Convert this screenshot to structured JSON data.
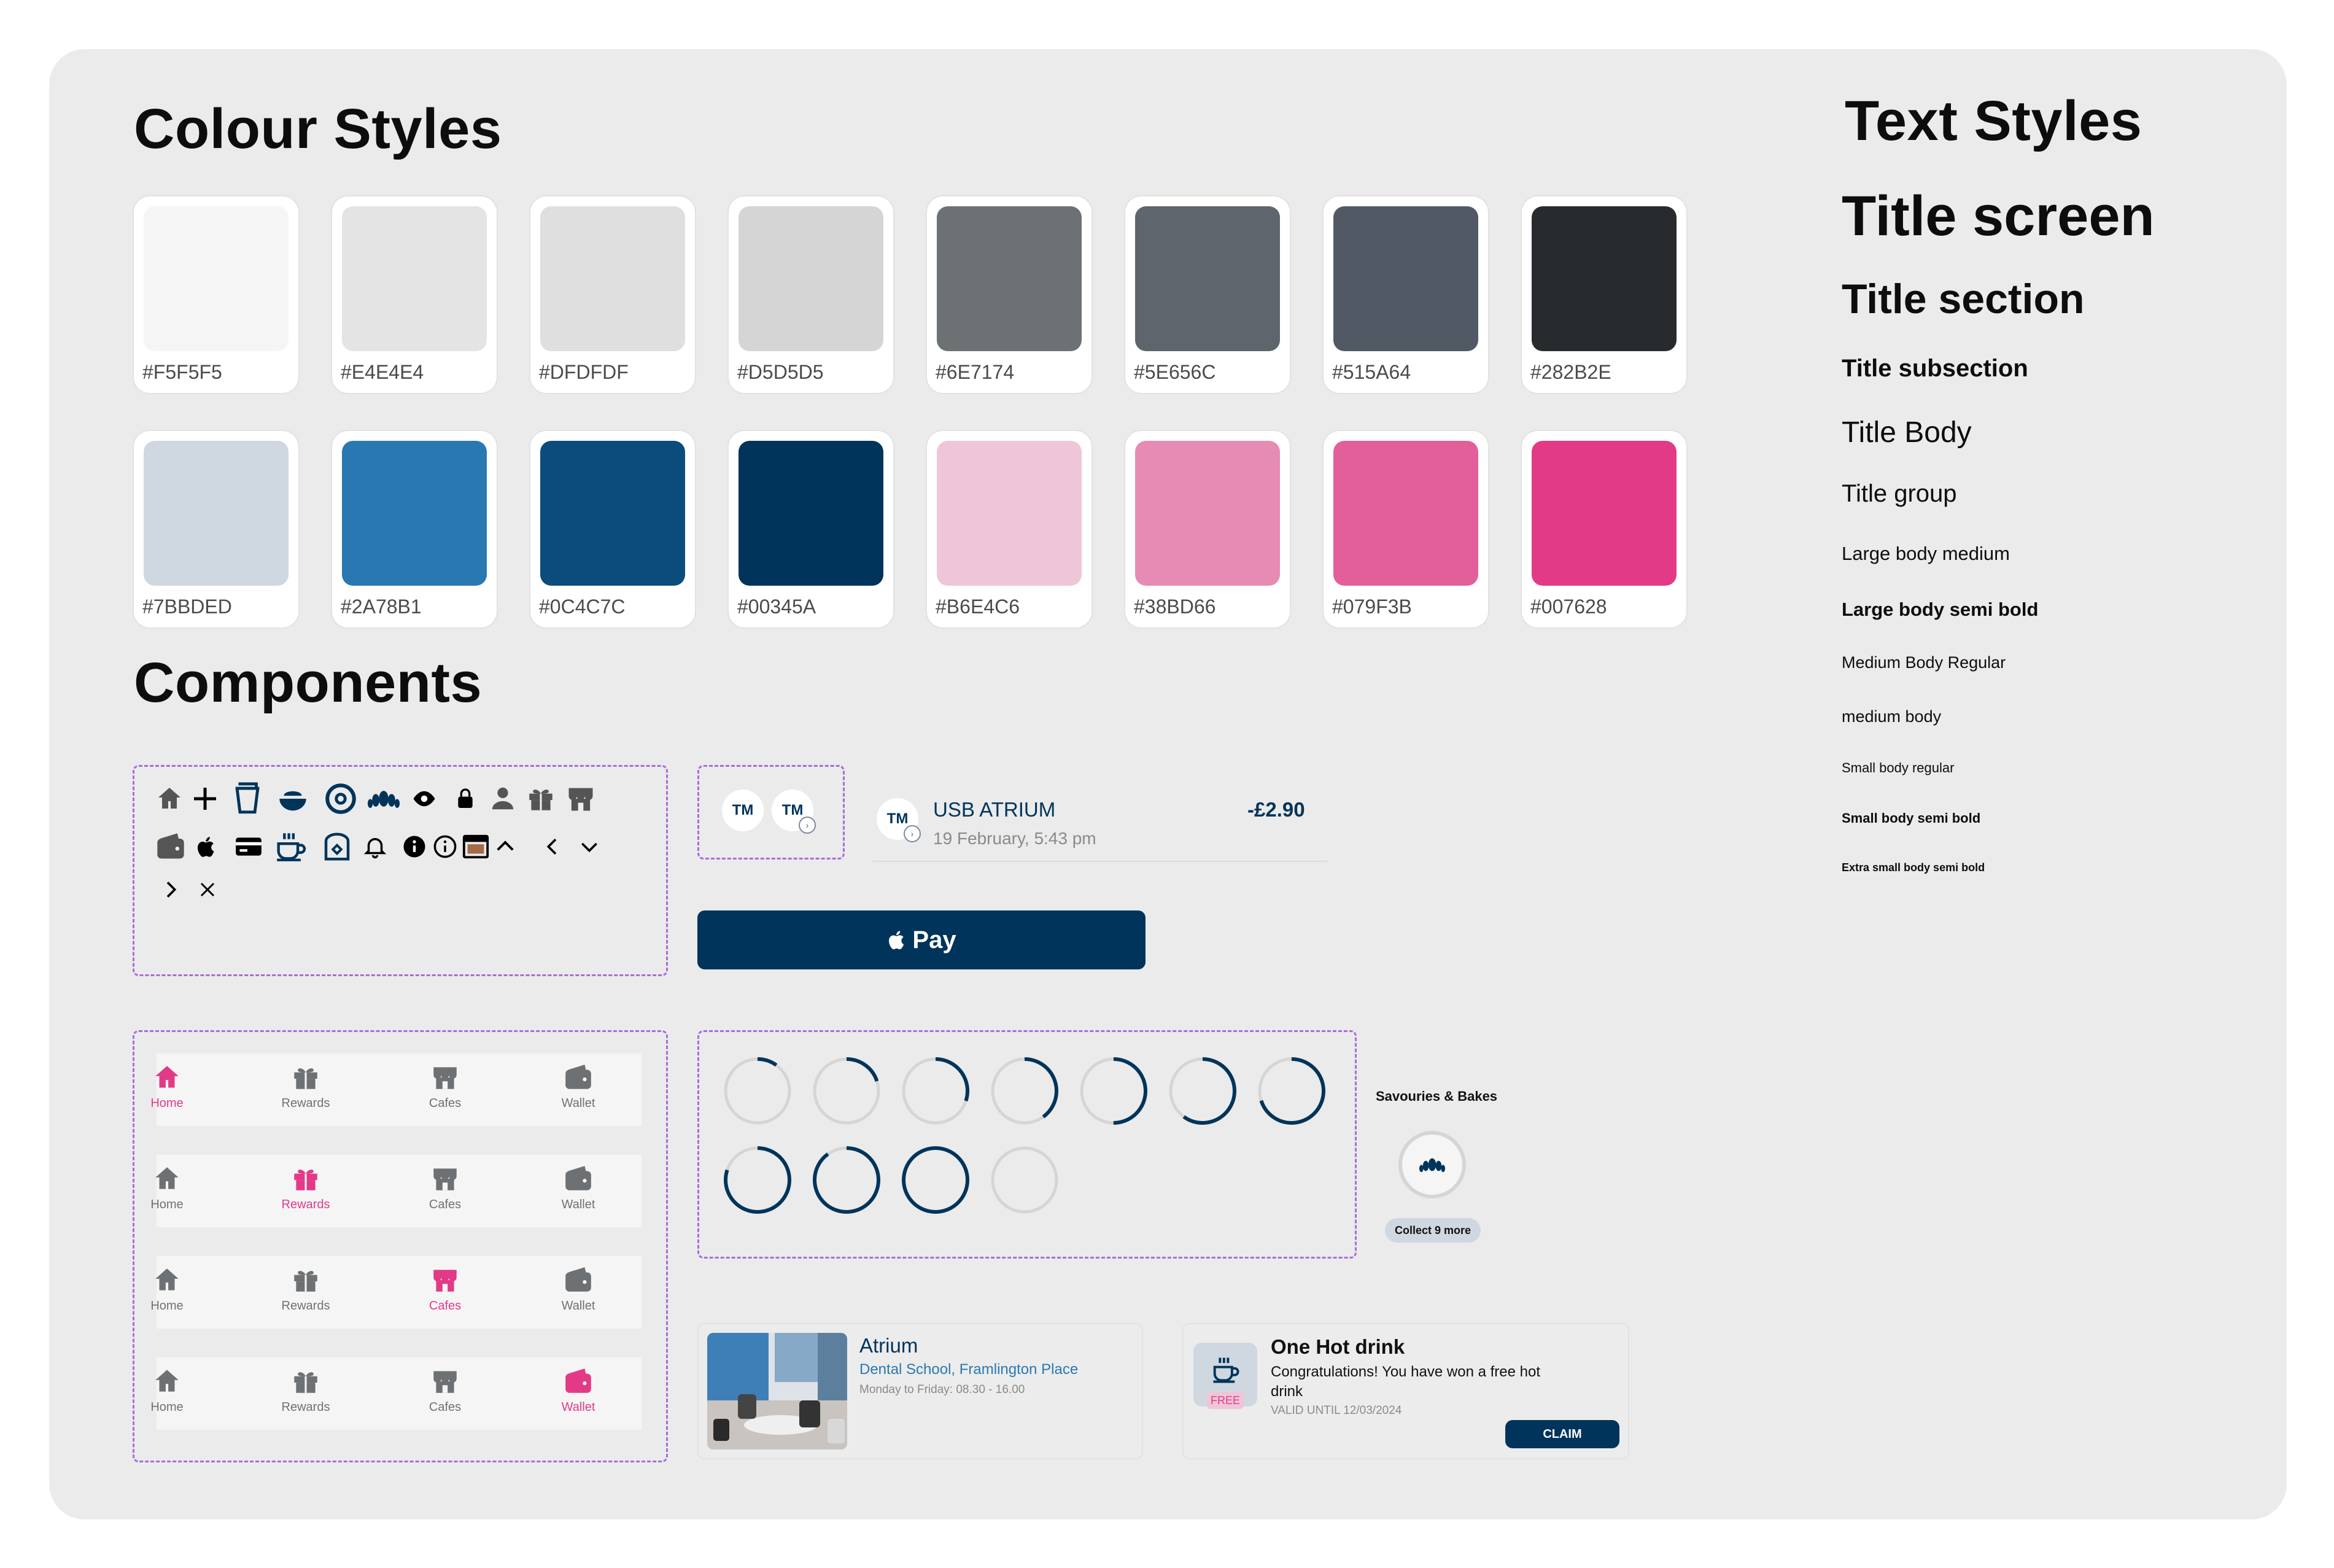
{
  "sections": {
    "colour_styles": "Colour Styles",
    "components": "Components",
    "text_styles": "Text Styles"
  },
  "swatches": [
    {
      "label": "#F5F5F5",
      "color": "#F5F5F5"
    },
    {
      "label": "#E4E4E4",
      "color": "#E4E4E4"
    },
    {
      "label": "#DFDFDF",
      "color": "#DFDFDF"
    },
    {
      "label": "#D5D5D5",
      "color": "#D5D5D5"
    },
    {
      "label": "#6E7174",
      "color": "#6E7174"
    },
    {
      "label": "#5E656C",
      "color": "#5E656C"
    },
    {
      "label": "#515A64",
      "color": "#515A64"
    },
    {
      "label": "#282B2E",
      "color": "#282B2E"
    },
    {
      "label": "#7BBDED",
      "color": "#CFD8E0"
    },
    {
      "label": "#2A78B1",
      "color": "#2A78B1"
    },
    {
      "label": "#0C4C7C",
      "color": "#0C4C7C"
    },
    {
      "label": "#00345A",
      "color": "#00345A"
    },
    {
      "label": "#B6E4C6",
      "color": "#EFC6D8"
    },
    {
      "label": "#38BD66",
      "color": "#E68BB4"
    },
    {
      "label": "#079F3B",
      "color": "#E35F99"
    },
    {
      "label": "#007628",
      "color": "#E23A87"
    }
  ],
  "text_styles": [
    {
      "label": "Title screen"
    },
    {
      "label": "Title section"
    },
    {
      "label": "Title subsection"
    },
    {
      "label": "Title Body"
    },
    {
      "label": "Title group"
    },
    {
      "label": "Large body medium"
    },
    {
      "label": "Large body semi bold"
    },
    {
      "label": "Medium Body Regular"
    },
    {
      "label": "medium body"
    },
    {
      "label": "Small body regular"
    },
    {
      "label": "Small body semi bold"
    },
    {
      "label": "Extra small body semi bold"
    }
  ],
  "icons": [
    "home-icon",
    "plus-icon",
    "cup-icon",
    "bowl-icon",
    "donut-icon",
    "croissant-icon",
    "eye-icon",
    "lock-icon",
    "user-icon",
    "gift-icon",
    "store-icon",
    "wallet-icon",
    "apple-icon",
    "card-icon",
    "coffee-icon",
    "toaster-icon",
    "bell-icon",
    "info-filled-icon",
    "info-outline-icon",
    "window-icon",
    "chevron-up-icon",
    "chevron-left-icon",
    "chevron-down-icon",
    "chevron-right-icon",
    "close-icon"
  ],
  "avatars": {
    "initials": "TM"
  },
  "transaction": {
    "initials": "TM",
    "title": "USB ATRIUM",
    "amount": "-£2.90",
    "date": "19 February, 5:43 pm"
  },
  "apple_pay": {
    "label": "Pay"
  },
  "nav_bars": [
    {
      "active": 0
    },
    {
      "active": 1
    },
    {
      "active": 2
    },
    {
      "active": 3
    }
  ],
  "nav_labels": [
    "Home",
    "Rewards",
    "Cafes",
    "Wallet"
  ],
  "progress_rings": [
    0.1,
    0.2,
    0.3,
    0.4,
    0.5,
    0.6,
    0.7,
    0.8,
    0.9,
    1.0,
    0.0
  ],
  "reward": {
    "title": "Savouries & Bakes",
    "collect": "Collect 9 more"
  },
  "cafe_card": {
    "name": "Atrium",
    "address": "Dental School, Framlington Place",
    "hours": "Monday to Friday: 08.30 - 16.00"
  },
  "offer_card": {
    "title": "One Hot drink",
    "message": "Congratulations! You have won a free hot drink",
    "badge": "FREE",
    "validity": "VALID UNTIL 12/03/2024",
    "button": "CLAIM"
  },
  "colors": {
    "navy": "#00345A",
    "pink": "#E23A87",
    "grey": "#6E7174"
  }
}
